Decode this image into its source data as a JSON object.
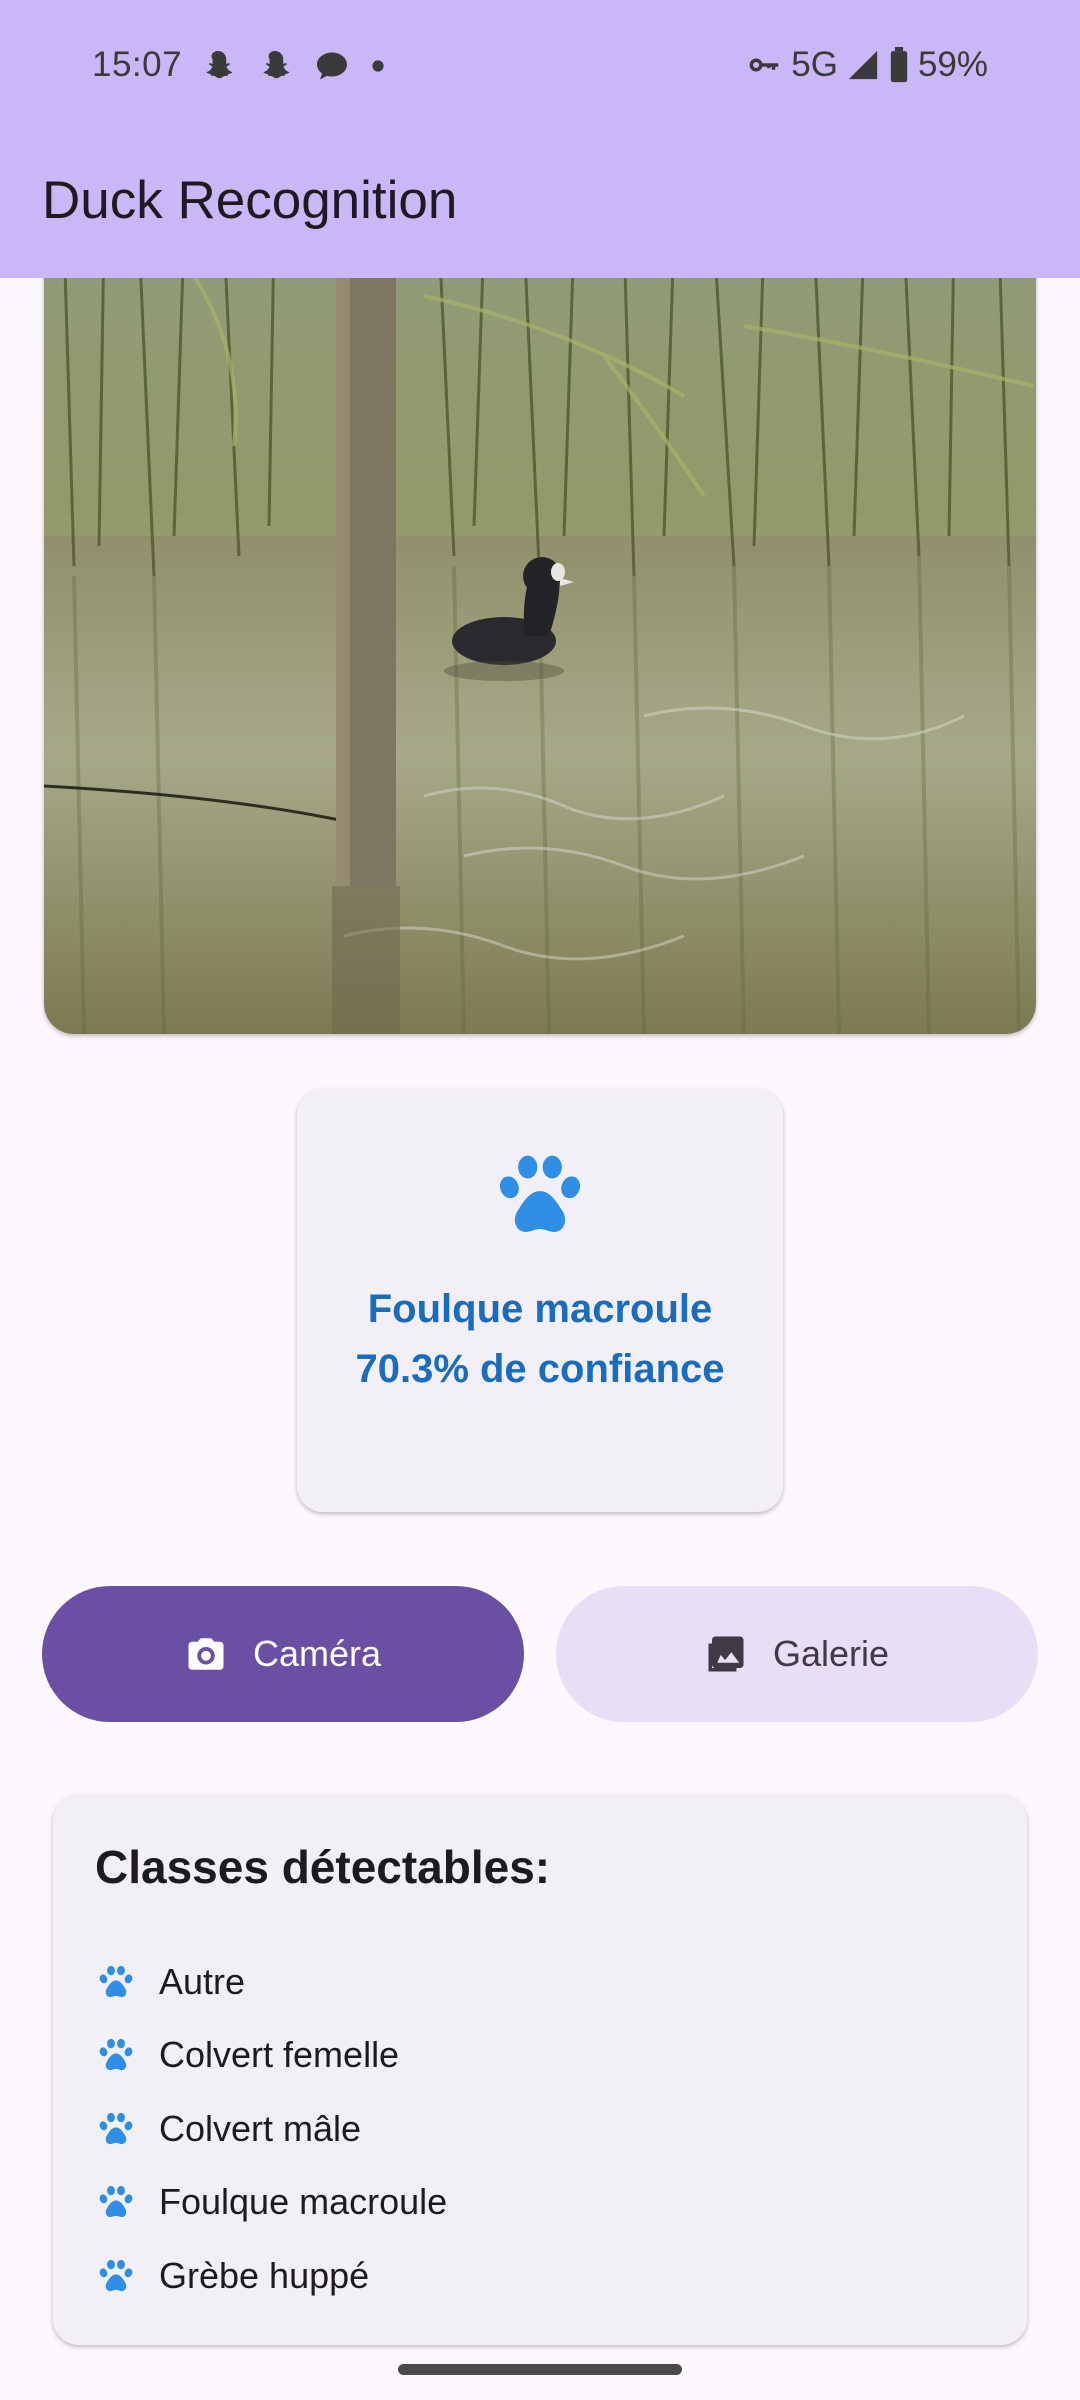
{
  "status_bar": {
    "time": "15:07",
    "notification_icons": [
      "snapchat-icon",
      "snapchat-icon",
      "chat-bubble-icon",
      "dot-icon"
    ],
    "network": "5G",
    "battery": "59%"
  },
  "app_bar": {
    "title": "Duck Recognition"
  },
  "photo": {
    "description_icon": "coot-photo"
  },
  "result": {
    "icon": "paw-icon",
    "label": "Foulque macroule",
    "confidence": "70.3% de confiance",
    "color": "#1a6cbd"
  },
  "actions": {
    "camera_label": "Caméra",
    "gallery_label": "Galerie",
    "primary_color": "#6a4fa4",
    "secondary_color": "#e8dff6"
  },
  "classes": {
    "title": "Classes détectables:",
    "items": [
      {
        "label": "Autre",
        "icon": "paw-icon"
      },
      {
        "label": "Colvert femelle",
        "icon": "paw-icon"
      },
      {
        "label": "Colvert mâle",
        "icon": "paw-icon"
      },
      {
        "label": "Foulque macroule",
        "icon": "paw-icon"
      },
      {
        "label": "Grèbe huppé",
        "icon": "paw-icon"
      }
    ]
  },
  "theme": {
    "top_bar": "#c9b7f8",
    "background": "#fdf7fe",
    "card": "#f3eff6",
    "accent_icon": "#2f8fe6"
  }
}
